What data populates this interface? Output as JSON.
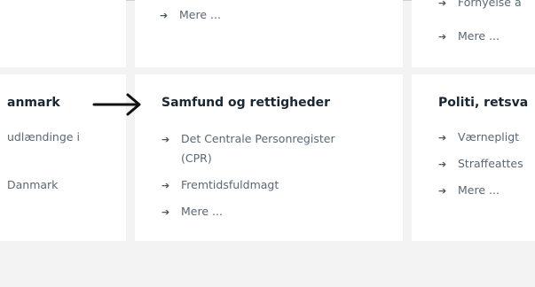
{
  "cards": {
    "left": {
      "heading": "anmark",
      "lines": [
        "udlændinge i",
        "Danmark"
      ]
    },
    "top_middle": {
      "more_label": "Mere ..."
    },
    "top_right": {
      "partial_item": "Fornyelse a",
      "more_label": "Mere ..."
    },
    "middle": {
      "heading": "Samfund og rettigheder",
      "items": [
        "Det Centrale Personregister",
        "(CPR)",
        "Fremtidsfuldmagt",
        "Mere ..."
      ]
    },
    "right": {
      "heading": "Politi, retsva",
      "items": [
        "Værnepligt",
        "Straffeattes",
        "Mere ..."
      ]
    }
  },
  "icons": {
    "link_arrow": "arrow-right-icon",
    "pointer_arrow": "long-arrow-right-icon"
  }
}
